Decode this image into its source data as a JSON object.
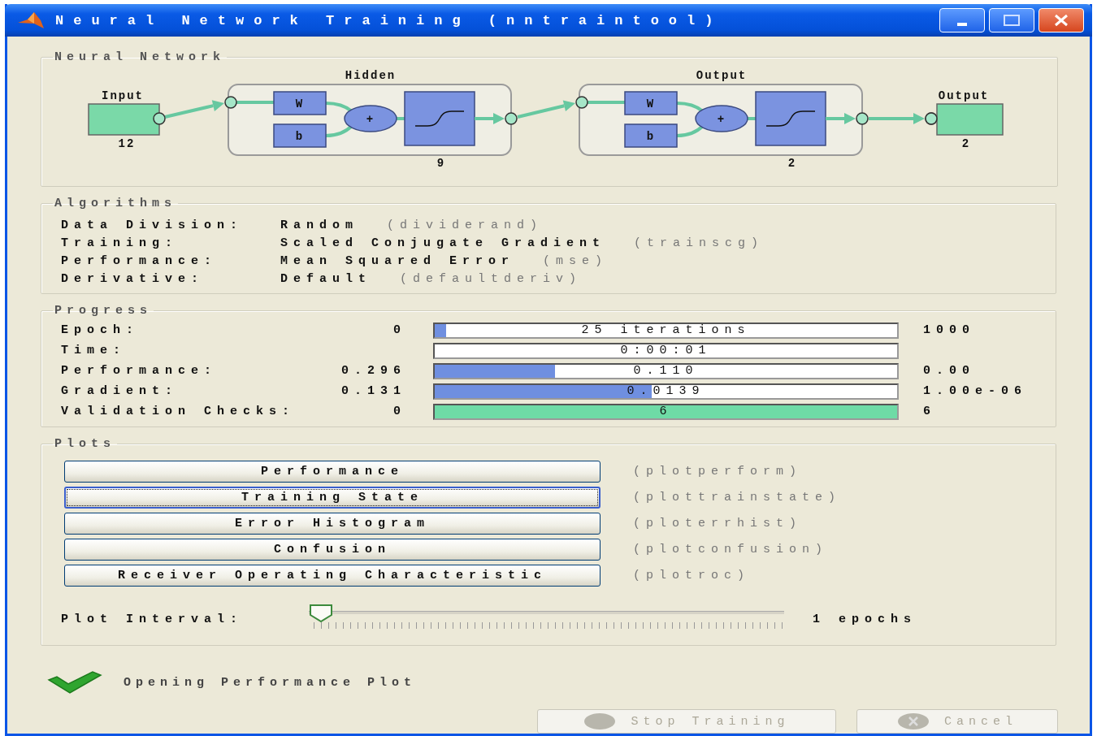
{
  "window": {
    "title": "Neural Network Training (nntraintool)"
  },
  "network": {
    "title": "Neural Network",
    "input": {
      "label": "Input",
      "size": "12"
    },
    "layers": [
      {
        "label": "Hidden",
        "size": "9",
        "weight": "W",
        "bias": "b",
        "sum": "+"
      },
      {
        "label": "Output",
        "size": "2",
        "weight": "W",
        "bias": "b",
        "sum": "+"
      }
    ],
    "output": {
      "label": "Output",
      "size": "2"
    }
  },
  "algorithms": {
    "title": "Algorithms",
    "rows": [
      {
        "label": "Data Division:",
        "value": "Random",
        "function": "(dividerand)"
      },
      {
        "label": "Training:",
        "value": "Scaled Conjugate Gradient",
        "function": "(trainscg)"
      },
      {
        "label": "Performance:",
        "value": "Mean Squared Error",
        "function": "(mse)"
      },
      {
        "label": "Derivative:",
        "value": "Default",
        "function": "(defaultderiv)"
      }
    ]
  },
  "progress": {
    "title": "Progress",
    "rows": [
      {
        "label": "Epoch:",
        "start": "0",
        "reading": "25 iterations",
        "level": 0.025,
        "color": "#6f8fe0",
        "end": "1000"
      },
      {
        "label": "Time:",
        "reading": "0:00:01"
      },
      {
        "label": "Performance:",
        "start": "0.296",
        "reading": "0.110",
        "level": 0.26,
        "color": "#6f8fe0",
        "end": "0.00"
      },
      {
        "label": "Gradient:",
        "start": "0.131",
        "reading": "0.0139",
        "level": 0.47,
        "color": "#6f8fe0",
        "end": "1.00e-06"
      },
      {
        "label": "Validation Checks:",
        "start": "0",
        "reading": "6",
        "level": 1,
        "color": "#6edba6",
        "end": "6"
      }
    ]
  },
  "plots": {
    "title": "Plots",
    "buttons": [
      {
        "label": "Performance",
        "function": "(plotperform)",
        "selected": false
      },
      {
        "label": "Training State",
        "function": "(plottrainstate)",
        "selected": true
      },
      {
        "label": "Error Histogram",
        "function": "(ploterrhist)",
        "selected": false
      },
      {
        "label": "Confusion",
        "function": "(plotconfusion)",
        "selected": false
      },
      {
        "label": "Receiver Operating Characteristic",
        "function": "(plotroc)",
        "selected": false
      }
    ],
    "interval": {
      "label": "Plot Interval:",
      "level": 0,
      "reading": "1 epochs"
    }
  },
  "status": {
    "text": "Opening Performance Plot"
  },
  "buttons": [
    {
      "kind": "stop",
      "label": "Stop Training",
      "disabled": true
    },
    {
      "kind": "cancel",
      "label": "Cancel",
      "disabled": true
    }
  ]
}
